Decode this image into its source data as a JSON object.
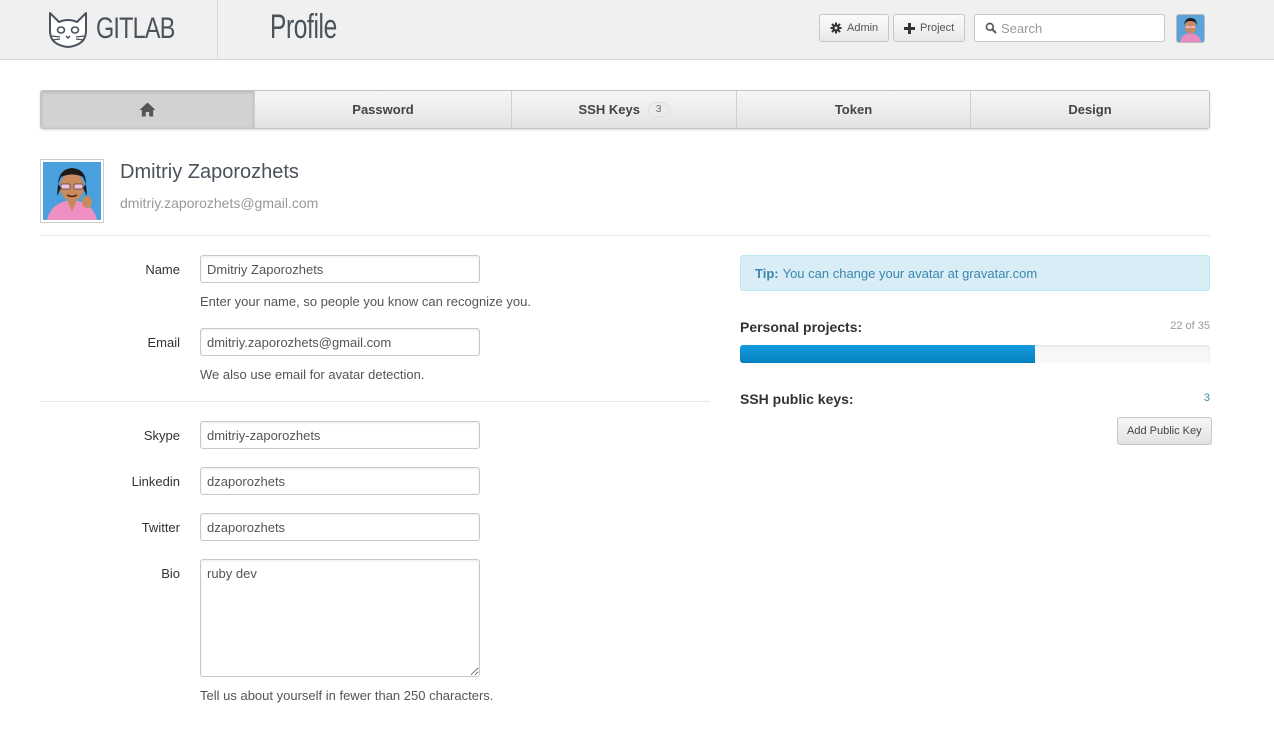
{
  "header": {
    "logo_text": "GITLAB",
    "title": "Profile",
    "admin_label": "Admin",
    "project_label": "Project",
    "search_placeholder": "Search"
  },
  "tabs": [
    {
      "label": "",
      "icon": "home-icon",
      "active": true
    },
    {
      "label": "Password"
    },
    {
      "label": "SSH Keys",
      "badge": "3"
    },
    {
      "label": "Token"
    },
    {
      "label": "Design"
    }
  ],
  "profile": {
    "name": "Dmitriy Zaporozhets",
    "email": "dmitriy.zaporozhets@gmail.com"
  },
  "form": {
    "name": {
      "label": "Name",
      "value": "Dmitriy Zaporozhets",
      "help": "Enter your name, so people you know can recognize you."
    },
    "email": {
      "label": "Email",
      "value": "dmitriy.zaporozhets@gmail.com",
      "help": "We also use email for avatar detection."
    },
    "skype": {
      "label": "Skype",
      "value": "dmitriy-zaporozhets"
    },
    "linkedin": {
      "label": "Linkedin",
      "value": "dzaporozhets"
    },
    "twitter": {
      "label": "Twitter",
      "value": "dzaporozhets"
    },
    "bio": {
      "label": "Bio",
      "value": "ruby dev",
      "help": "Tell us about yourself in fewer than 250 characters."
    }
  },
  "sidebar": {
    "tip_label": "Tip:",
    "tip_text": "You can change your avatar at gravatar.com",
    "projects_label": "Personal projects:",
    "projects_count": "22 of 35",
    "projects_fraction": 0.628,
    "ssh_label": "SSH public keys:",
    "ssh_count": "3",
    "add_key_label": "Add Public Key"
  },
  "colors": {
    "progress": "#0e90d2",
    "tip_bg": "#d9edf7",
    "tip_text": "#3a87ad"
  }
}
